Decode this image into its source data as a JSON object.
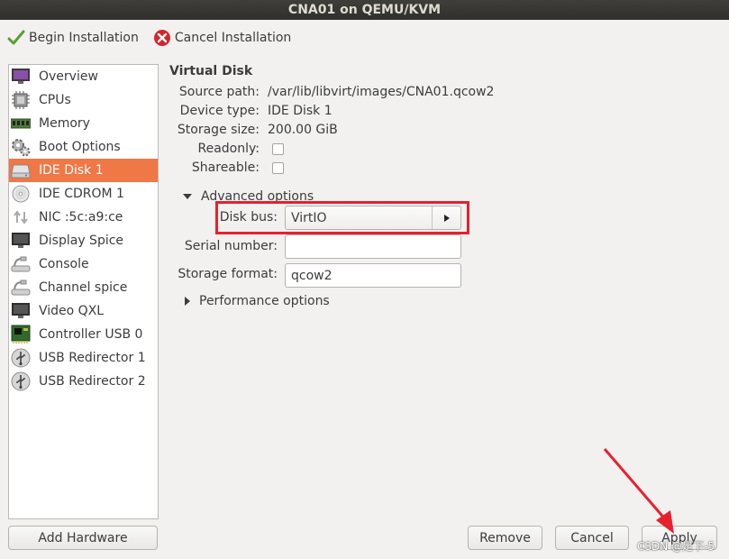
{
  "window": {
    "title": "CNA01 on QEMU/KVM"
  },
  "toolbar": {
    "begin_label": "Begin Installation",
    "cancel_label": "Cancel Installation"
  },
  "sidebar": {
    "items": [
      {
        "label": "Overview",
        "icon": "monitor-icon"
      },
      {
        "label": "CPUs",
        "icon": "cpu-icon"
      },
      {
        "label": "Memory",
        "icon": "memory-icon"
      },
      {
        "label": "Boot Options",
        "icon": "gears-icon"
      },
      {
        "label": "IDE Disk 1",
        "icon": "harddisk-icon",
        "selected": true
      },
      {
        "label": "IDE CDROM 1",
        "icon": "cdrom-icon"
      },
      {
        "label": "NIC :5c:a9:ce",
        "icon": "network-arrows-icon"
      },
      {
        "label": "Display Spice",
        "icon": "display-icon"
      },
      {
        "label": "Console",
        "icon": "serial-icon"
      },
      {
        "label": "Channel spice",
        "icon": "serial-icon"
      },
      {
        "label": "Video QXL",
        "icon": "display-icon"
      },
      {
        "label": "Controller USB 0",
        "icon": "pcicard-icon"
      },
      {
        "label": "USB Redirector 1",
        "icon": "usb-icon"
      },
      {
        "label": "USB Redirector 2",
        "icon": "usb-icon"
      }
    ]
  },
  "details": {
    "section_title": "Virtual Disk",
    "source_path_label": "Source path:",
    "source_path_value": "/var/lib/libvirt/images/CNA01.qcow2",
    "device_type_label": "Device type:",
    "device_type_value": "IDE Disk 1",
    "storage_size_label": "Storage size:",
    "storage_size_value": "200.00 GiB",
    "readonly_label": "Readonly:",
    "readonly_checked": false,
    "shareable_label": "Shareable:",
    "shareable_checked": false,
    "advanced_label": "Advanced options",
    "disk_bus_label": "Disk bus:",
    "disk_bus_value": "VirtIO",
    "serial_label": "Serial number:",
    "serial_value": "",
    "storage_format_label": "Storage format:",
    "storage_format_value": "qcow2",
    "performance_label": "Performance options"
  },
  "buttons": {
    "add_hardware": "Add Hardware",
    "remove": "Remove",
    "cancel": "Cancel",
    "apply": "Apply"
  },
  "watermark": "CSDN @足下-5",
  "colors": {
    "selection": "#f07746",
    "titlebar": "#3a3935",
    "annotation": "#e8202e"
  }
}
